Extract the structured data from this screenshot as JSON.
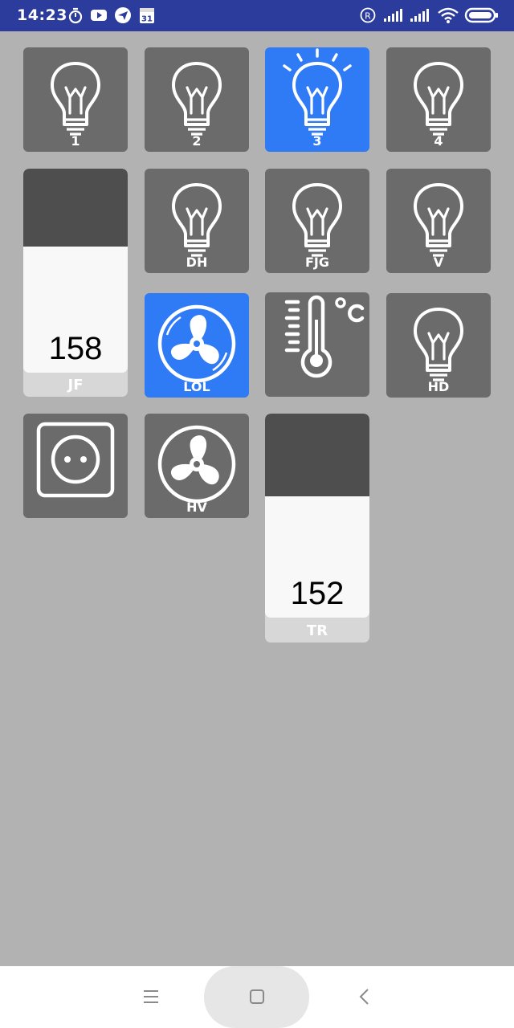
{
  "status_bar": {
    "time": "14:23",
    "icons": [
      "stopwatch-icon",
      "youtube-icon",
      "telegram-icon",
      "calendar-icon",
      "registered-icon",
      "signal-icon",
      "signal-icon",
      "wifi-icon",
      "battery-icon"
    ],
    "calendar_day": "31",
    "registered_mark": "R",
    "background_color": "#2b3c9d"
  },
  "tiles": [
    {
      "label": "1",
      "icon": "light-bulb-icon",
      "state": "off"
    },
    {
      "label": "2",
      "icon": "light-bulb-icon",
      "state": "off"
    },
    {
      "label": "3",
      "icon": "light-bulb-icon",
      "state": "on"
    },
    {
      "label": "4",
      "icon": "light-bulb-icon",
      "state": "off"
    },
    {
      "label": "DH",
      "icon": "light-bulb-icon",
      "state": "off"
    },
    {
      "label": "FJG",
      "icon": "light-bulb-icon",
      "state": "off"
    },
    {
      "label": "V",
      "icon": "light-bulb-icon",
      "state": "off"
    },
    {
      "label": "LOL",
      "icon": "fan-icon",
      "state": "on"
    },
    {
      "label": "",
      "icon": "thermometer-icon",
      "state": "off",
      "unit": "°C"
    },
    {
      "label": "HD",
      "icon": "light-bulb-icon",
      "state": "off"
    },
    {
      "label": "",
      "icon": "power-socket-icon",
      "state": "off"
    },
    {
      "label": "HV",
      "icon": "fan-icon",
      "state": "off"
    }
  ],
  "sliders": [
    {
      "label": "JF",
      "value": "158",
      "level_fraction": 0.62
    },
    {
      "label": "TR",
      "value": "152",
      "level_fraction": 0.6
    }
  ],
  "colors": {
    "background": "#b2b2b2",
    "tile_off": "#6b6b6b",
    "tile_on": "#2f7af5",
    "slider_fill": "#f8f8f8",
    "slider_empty": "#4e4e4e"
  },
  "nav_bar": {
    "buttons": [
      "menu-icon",
      "home-icon",
      "back-icon"
    ]
  }
}
